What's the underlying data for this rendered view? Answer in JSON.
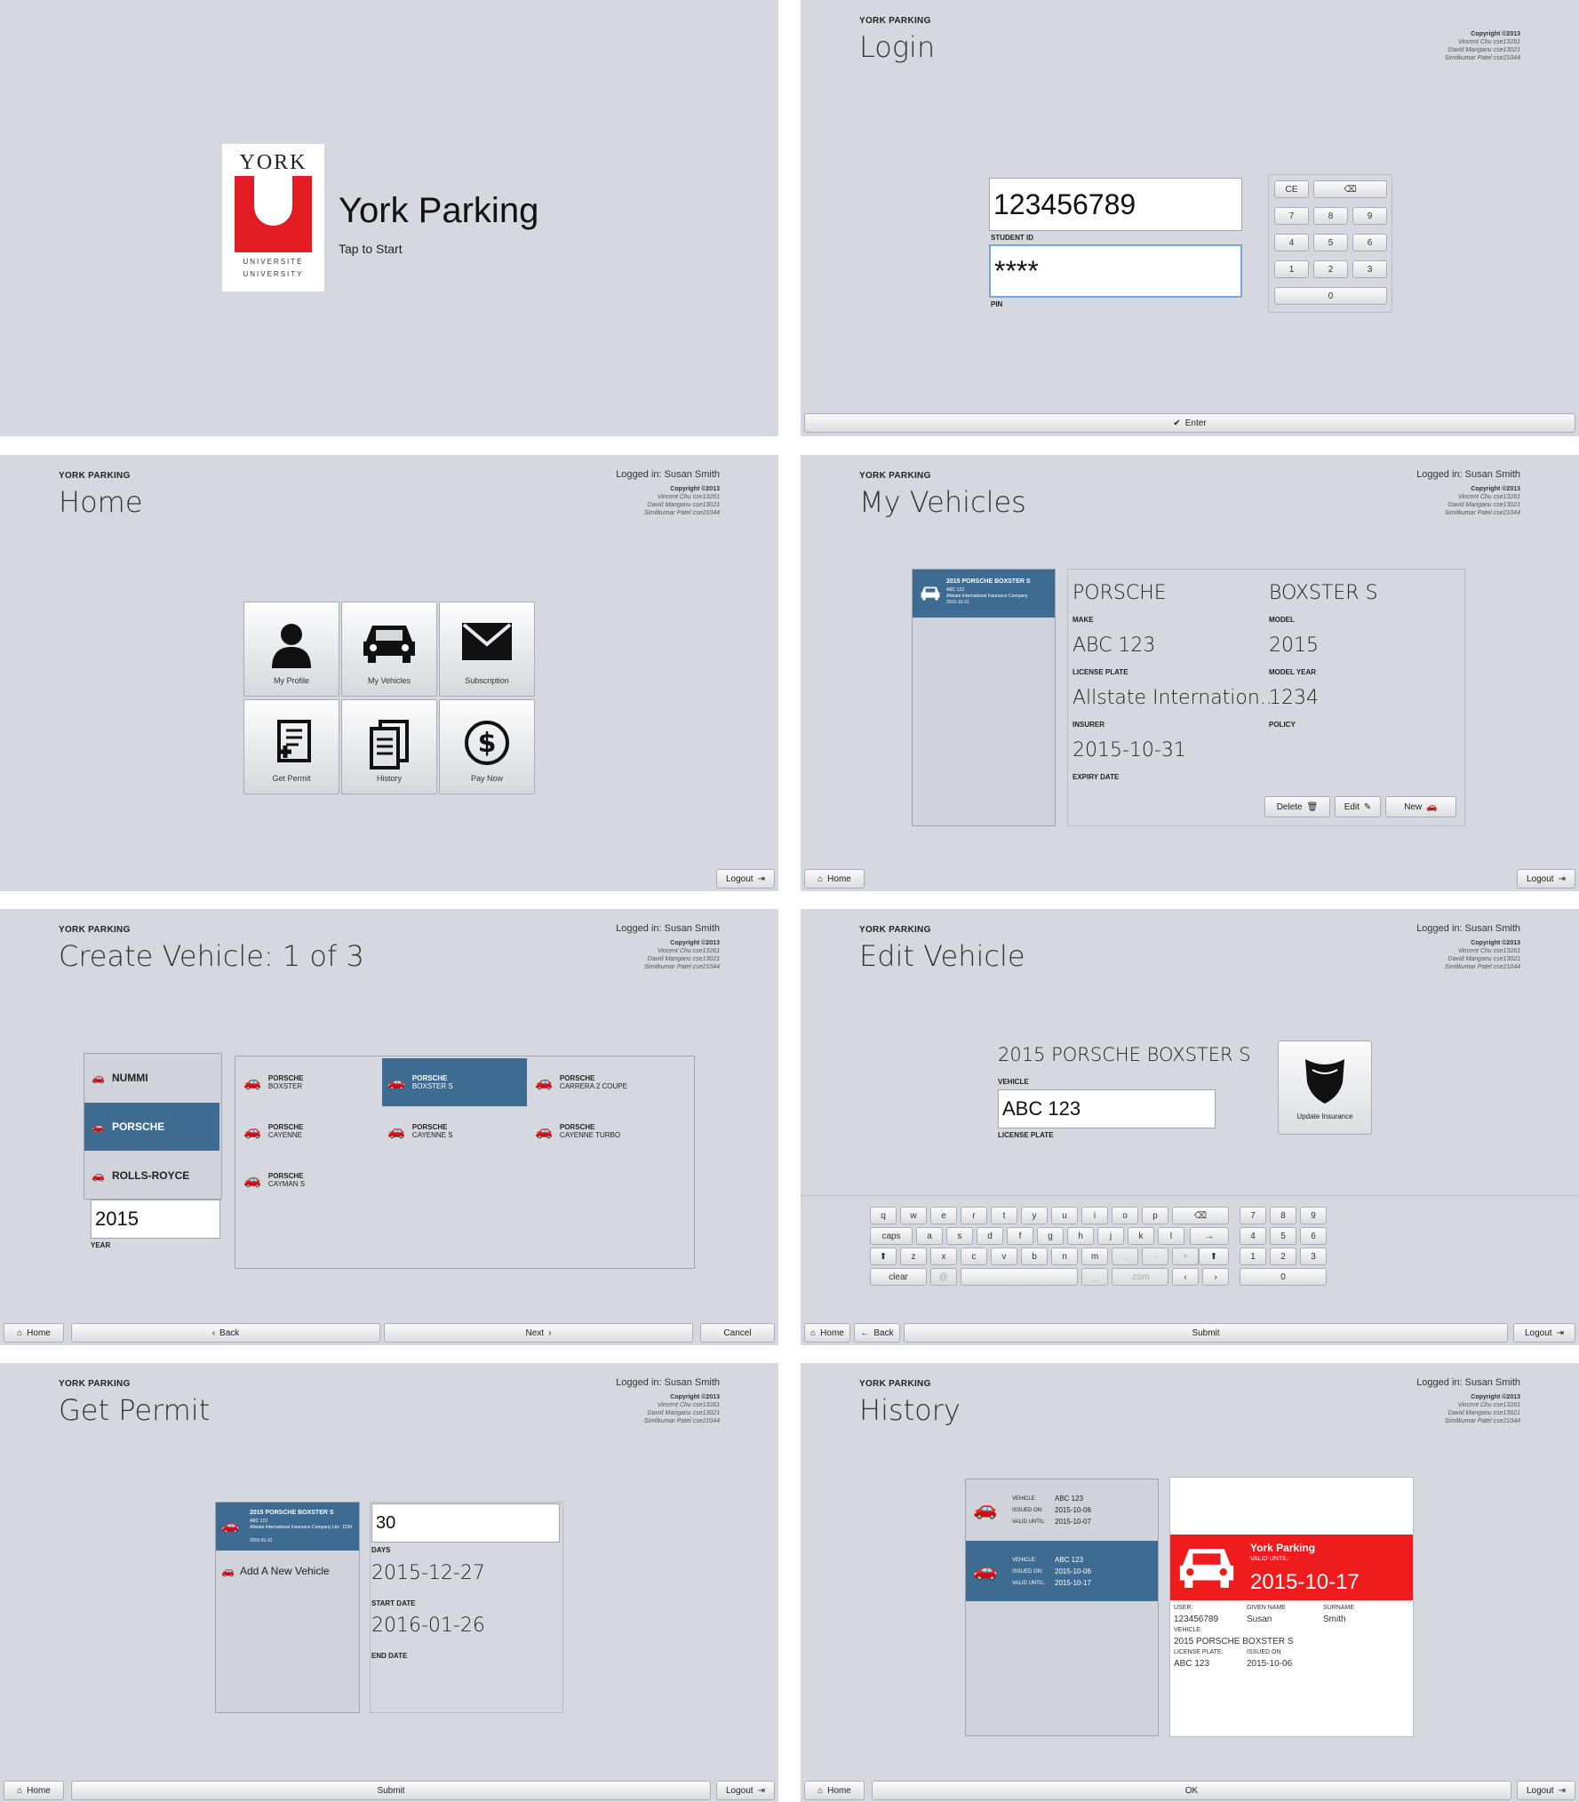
{
  "app": {
    "brand": "YORK PARKING",
    "logged_in": "Logged in: Susan Smith",
    "copyright": "Copyright ©2013",
    "authors": [
      "Vincent Chu cse13261",
      "David Manganu cse13021",
      "Simitkumar Patel cse21044"
    ]
  },
  "splash": {
    "logo_top": "YORK",
    "logo_mid": "UNIVERSITÉ",
    "logo_bottom": "UNIVERSITY",
    "title": "York Parking",
    "subtitle": "Tap to Start"
  },
  "login": {
    "title": "Login",
    "student_id": "123456789",
    "student_id_label": "STUDENT ID",
    "pin": "****",
    "pin_label": "PIN",
    "keys": [
      "CE",
      "7",
      "8",
      "9",
      "4",
      "5",
      "6",
      "1",
      "2",
      "3",
      "0"
    ],
    "enter": "Enter"
  },
  "home": {
    "title": "Home",
    "tiles": [
      "My Profile",
      "My Vehicles",
      "Subscription",
      "Get Permit",
      "History",
      "Pay Now"
    ],
    "logout": "Logout"
  },
  "vehicles": {
    "title": "My Vehicles",
    "list_item": {
      "name": "2015 PORSCHE BOXSTER S",
      "plate": "ABC 123",
      "insurer": "Allstate International Insurance Company",
      "date": "2015-10-31"
    },
    "make": "PORSCHE",
    "make_label": "MAKE",
    "model": "BOXSTER S",
    "model_label": "MODEL",
    "plate": "ABC 123",
    "plate_label": "LICENSE PLATE",
    "year": "2015",
    "year_label": "MODEL YEAR",
    "insurer": "Allstate Internation...",
    "insurer_label": "INSURER",
    "policy": "1234",
    "policy_label": "POLICY",
    "expiry": "2015-10-31",
    "expiry_label": "EXPIRY DATE",
    "delete": "Delete",
    "edit": "Edit",
    "new": "New",
    "home": "Home",
    "logout": "Logout"
  },
  "create": {
    "title": "Create Vehicle: 1 of 3",
    "makes": [
      "NUMMI",
      "PORSCHE",
      "ROLLS-ROYCE"
    ],
    "year": "2015",
    "year_label": "YEAR",
    "models": [
      [
        "PORSCHE",
        "BOXSTER"
      ],
      [
        "PORSCHE",
        "BOXSTER S"
      ],
      [
        "PORSCHE",
        "CARRERA 2 COUPE"
      ],
      [
        "PORSCHE",
        "CAYENNE"
      ],
      [
        "PORSCHE",
        "CAYENNE S"
      ],
      [
        "PORSCHE",
        "CAYENNE TURBO"
      ],
      [
        "PORSCHE",
        "CAYMAN S"
      ]
    ],
    "home": "Home",
    "back": "Back",
    "next": "Next",
    "cancel": "Cancel"
  },
  "edit": {
    "title": "Edit Vehicle",
    "vehicle": "2015 PORSCHE BOXSTER S",
    "vehicle_label": "VEHICLE",
    "plate": "ABC 123",
    "plate_label": "LICENSE PLATE",
    "update": "Update Insurance",
    "row1": [
      "q",
      "w",
      "e",
      "r",
      "t",
      "y",
      "u",
      "i",
      "o",
      "p"
    ],
    "row2": [
      "caps",
      "a",
      "s",
      "d",
      "f",
      "g",
      "h",
      "j",
      "k",
      "l"
    ],
    "row3": [
      "z",
      "x",
      "c",
      "v",
      "b",
      "n",
      "m",
      ".",
      "-",
      "+"
    ],
    "clear": "clear",
    "at": "@",
    "underscore": "_",
    ".com": ".com",
    "num": [
      "7",
      "8",
      "9",
      "4",
      "5",
      "6",
      "1",
      "2",
      "3",
      "0"
    ],
    "home": "Home",
    "back": "Back",
    "submit": "Submit",
    "logout": "Logout"
  },
  "permit": {
    "title": "Get Permit",
    "item": {
      "name": "2015 PORSCHE BOXSTER S",
      "plate": "ABC 123",
      "insurer": "Allstate International Insurance Company Ltd.: 1234",
      "date": "2015-01-31"
    },
    "add": "Add A New Vehicle",
    "days": "30",
    "days_label": "DAYS",
    "start": "2015-12-27",
    "start_label": "START DATE",
    "end": "2016-01-26",
    "end_label": "END DATE",
    "home": "Home",
    "submit": "Submit",
    "logout": "Logout"
  },
  "history": {
    "title": "History",
    "rows": [
      {
        "vehicle": "ABC 123",
        "issued": "2015-10-06",
        "valid": "2015-10-07"
      },
      {
        "vehicle": "ABC 123",
        "issued": "2015-10-06",
        "valid": "2015-10-17"
      }
    ],
    "row_labels": [
      "VEHICLE:",
      "ISSUED ON:",
      "VALID UNTIL:"
    ],
    "card": {
      "brand": "York Parking",
      "valid_label": "VALID UNTIL:",
      "valid": "2015-10-17",
      "user_label": "USER:",
      "user": "123456789",
      "given_label": "GIVEN NAME",
      "given": "Susan",
      "surname_label": "SURNAME",
      "surname": "Smith",
      "vehicle_label": "VEHICLE:",
      "vehicle": "2015 PORSCHE BOXSTER S",
      "plate_label": "LICENSE PLATE:",
      "plate": "ABC 123",
      "issued_label": "ISSUED ON",
      "issued": "2015-10-06"
    },
    "home": "Home",
    "ok": "OK",
    "logout": "Logout"
  }
}
